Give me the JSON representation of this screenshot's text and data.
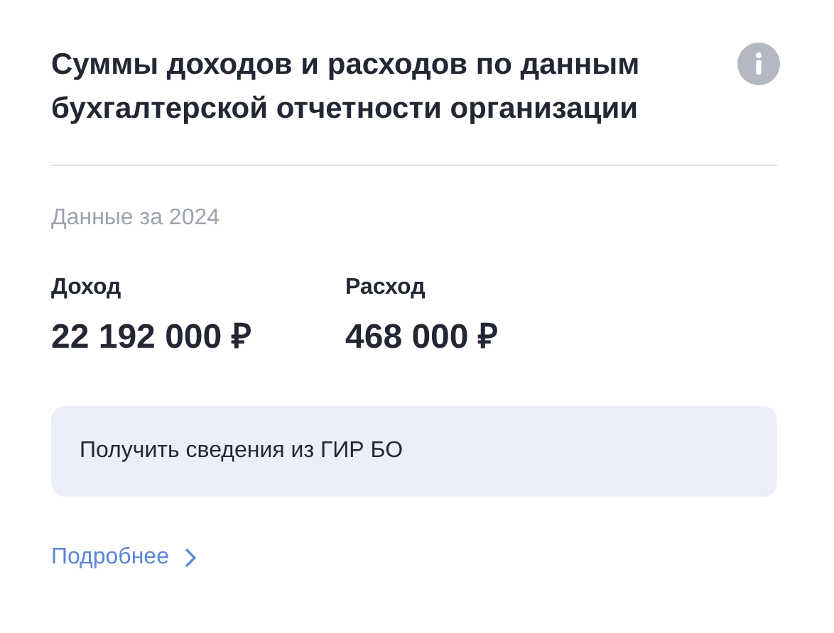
{
  "card": {
    "title": "Суммы доходов и расходов по данным бухгалтерской отчетности организации",
    "period": "Данные за 2024",
    "metrics": [
      {
        "label": "Доход",
        "value": "22 192 000 ₽"
      },
      {
        "label": "Расход",
        "value": "468 000 ₽"
      }
    ],
    "notice": "Получить сведения из ГИР БО",
    "more_link": "Подробнее"
  }
}
